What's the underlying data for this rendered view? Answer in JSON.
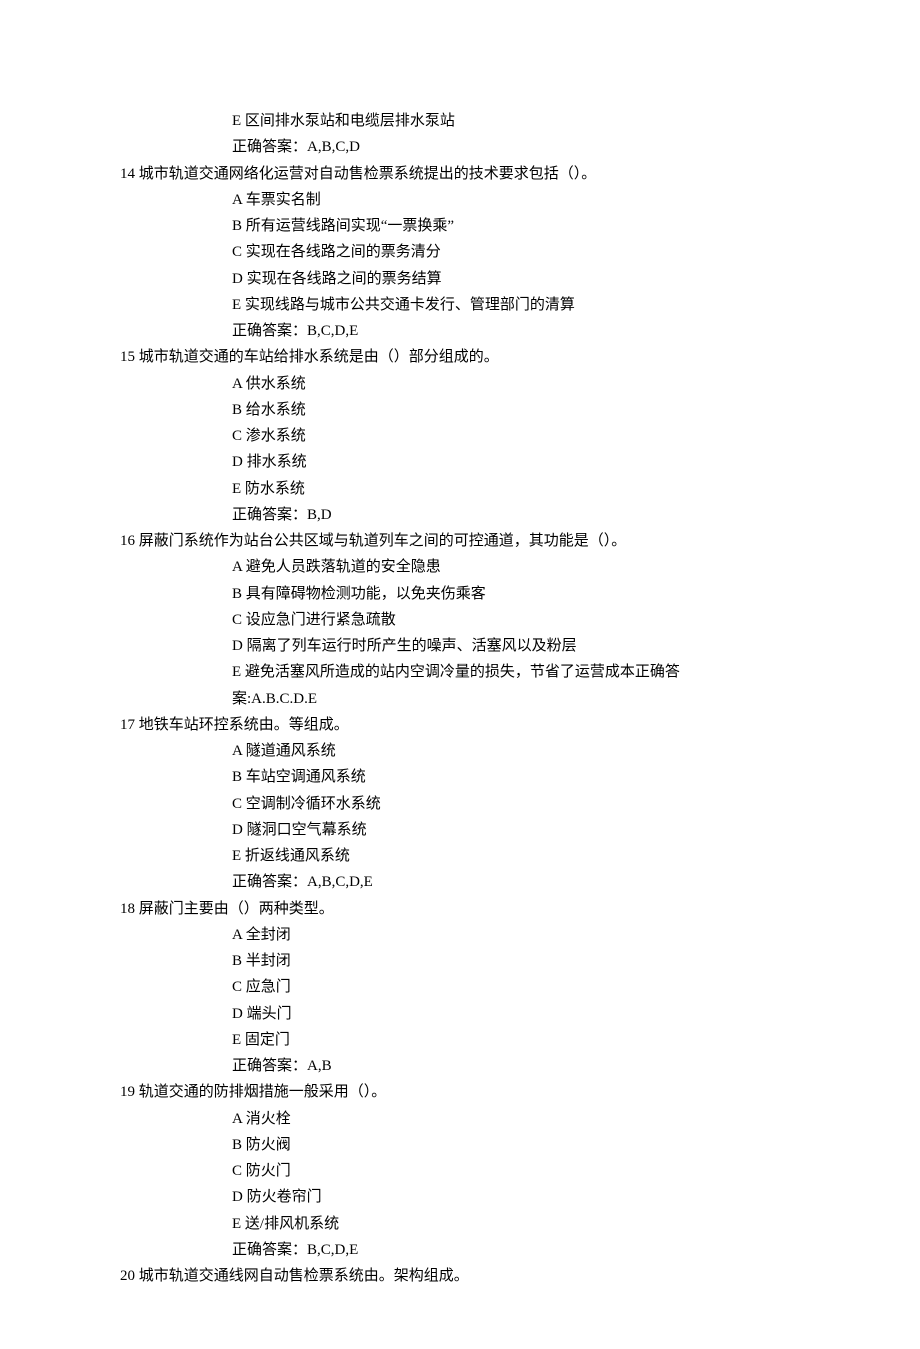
{
  "lines": [
    {
      "cls": "opt-line",
      "path": "q13.optE"
    },
    {
      "cls": "opt-line",
      "path": "q13.answer"
    },
    {
      "cls": "q-line",
      "path": "q14.stem"
    },
    {
      "cls": "opt-line",
      "path": "q14.optA"
    },
    {
      "cls": "opt-line",
      "path": "q14.optB"
    },
    {
      "cls": "opt-line",
      "path": "q14.optC"
    },
    {
      "cls": "opt-line",
      "path": "q14.optD"
    },
    {
      "cls": "opt-line",
      "path": "q14.optE"
    },
    {
      "cls": "opt-line",
      "path": "q14.answer"
    },
    {
      "cls": "q-line",
      "path": "q15.stem"
    },
    {
      "cls": "opt-line",
      "path": "q15.optA"
    },
    {
      "cls": "opt-line",
      "path": "q15.optB"
    },
    {
      "cls": "opt-line",
      "path": "q15.optC"
    },
    {
      "cls": "opt-line",
      "path": "q15.optD"
    },
    {
      "cls": "opt-line",
      "path": "q15.optE"
    },
    {
      "cls": "opt-line",
      "path": "q15.answer"
    },
    {
      "cls": "q-line",
      "path": "q16.stem"
    },
    {
      "cls": "opt-line",
      "path": "q16.optA"
    },
    {
      "cls": "opt-line",
      "path": "q16.optB"
    },
    {
      "cls": "opt-line",
      "path": "q16.optC"
    },
    {
      "cls": "opt-line",
      "path": "q16.optD"
    },
    {
      "cls": "opt-line",
      "path": "q16.optE1"
    },
    {
      "cls": "opt-line",
      "path": "q16.optE2"
    },
    {
      "cls": "q-line",
      "path": "q17.stem"
    },
    {
      "cls": "opt-line",
      "path": "q17.optA"
    },
    {
      "cls": "opt-line",
      "path": "q17.optB"
    },
    {
      "cls": "opt-line",
      "path": "q17.optC"
    },
    {
      "cls": "opt-line",
      "path": "q17.optD"
    },
    {
      "cls": "opt-line",
      "path": "q17.optE"
    },
    {
      "cls": "opt-line",
      "path": "q17.answer"
    },
    {
      "cls": "q-line",
      "path": "q18.stem"
    },
    {
      "cls": "opt-line",
      "path": "q18.optA"
    },
    {
      "cls": "opt-line",
      "path": "q18.optB"
    },
    {
      "cls": "opt-line",
      "path": "q18.optC"
    },
    {
      "cls": "opt-line",
      "path": "q18.optD"
    },
    {
      "cls": "opt-line",
      "path": "q18.optE"
    },
    {
      "cls": "opt-line",
      "path": "q18.answer"
    },
    {
      "cls": "q-line",
      "path": "q19.stem"
    },
    {
      "cls": "opt-line",
      "path": "q19.optA"
    },
    {
      "cls": "opt-line",
      "path": "q19.optB"
    },
    {
      "cls": "opt-line",
      "path": "q19.optC"
    },
    {
      "cls": "opt-line",
      "path": "q19.optD"
    },
    {
      "cls": "opt-line",
      "path": "q19.optE"
    },
    {
      "cls": "opt-line",
      "path": "q19.answer"
    },
    {
      "cls": "q-line",
      "path": "q20.stem"
    }
  ],
  "q13": {
    "optE": "E 区间排水泵站和电缆层排水泵站",
    "answer": "正确答案：A,B,C,D"
  },
  "q14": {
    "stem": "14 城市轨道交通网络化运营对自动售检票系统提出的技术要求包括（）。",
    "optA": "A 车票实名制",
    "optB": "B 所有运营线路间实现“一票换乘”",
    "optC": "C 实现在各线路之间的票务清分",
    "optD": "D 实现在各线路之间的票务结算",
    "optE": "E 实现线路与城市公共交通卡发行、管理部门的清算",
    "answer": "正确答案：B,C,D,E"
  },
  "q15": {
    "stem": "15 城市轨道交通的车站给排水系统是由（）部分组成的。",
    "optA": "A 供水系统",
    "optB": "B 给水系统",
    "optC": "C 渗水系统",
    "optD": "D 排水系统",
    "optE": "E 防水系统",
    "answer": "正确答案：B,D"
  },
  "q16": {
    "stem": "16 屏蔽门系统作为站台公共区域与轨道列车之间的可控通道，其功能是（）。",
    "optA": "A 避免人员跌落轨道的安全隐患",
    "optB": "B 具有障碍物检测功能，以免夹伤乘客",
    "optC": "C 设应急门进行紧急疏散",
    "optD": "D 隔离了列车运行时所产生的噪声、活塞风以及粉层",
    "optE1": "E 避免活塞风所造成的站内空调冷量的损失，节省了运营成本正确答",
    "optE2": "案:A.B.C.D.E"
  },
  "q17": {
    "stem": "17 地铁车站环控系统由。等组成。",
    "optA": "A 隧道通风系统",
    "optB": "B 车站空调通风系统",
    "optC": "C 空调制冷循环水系统",
    "optD": "D 隧洞口空气幕系统",
    "optE": "E 折返线通风系统",
    "answer": "正确答案：A,B,C,D,E"
  },
  "q18": {
    "stem": "18 屏蔽门主要由（）两种类型。",
    "optA": "A 全封闭",
    "optB": "B 半封闭",
    "optC": "C 应急门",
    "optD": "D 端头门",
    "optE": "E 固定门",
    "answer": "正确答案：A,B"
  },
  "q19": {
    "stem": "19 轨道交通的防排烟措施一般采用（）。",
    "optA": "A 消火栓",
    "optB": "B 防火阀",
    "optC": "C 防火门",
    "optD": "D 防火卷帘门",
    "optE": "E 送/排风机系统",
    "answer": "正确答案：B,C,D,E"
  },
  "q20": {
    "stem": "20 城市轨道交通线网自动售检票系统由。架构组成。"
  }
}
